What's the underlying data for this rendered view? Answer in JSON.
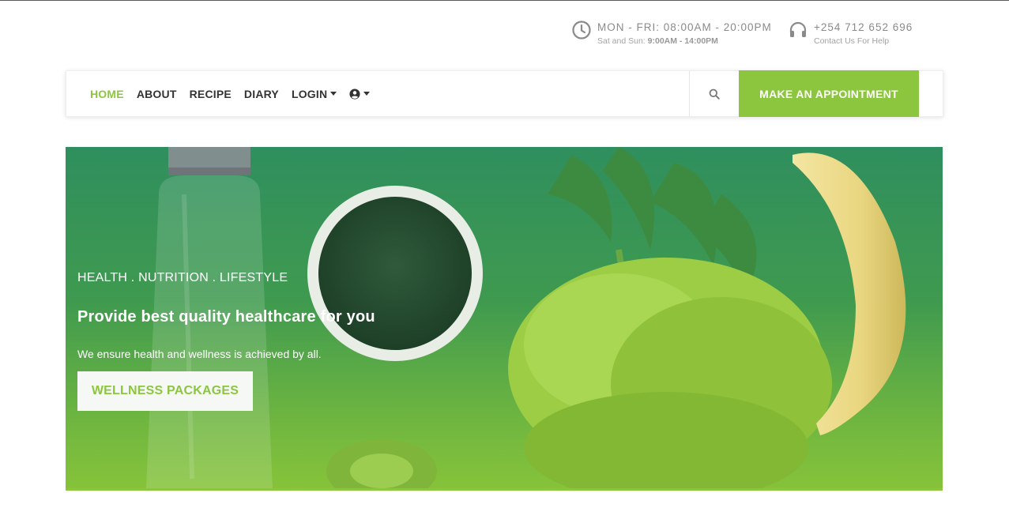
{
  "topbar": {
    "hours": {
      "icon": "clock-icon",
      "line1": "MON - FRI: 08:00AM - 20:00PM",
      "line2_label": "Sat and Sun: ",
      "line2_value": "9:00AM - 14:00PM"
    },
    "phone": {
      "icon": "headset-icon",
      "line1": "+254 712 652 696",
      "line2": "Contact Us For Help"
    }
  },
  "nav": {
    "links": [
      {
        "label": "HOME",
        "active": true
      },
      {
        "label": "ABOUT"
      },
      {
        "label": "RECIPE"
      },
      {
        "label": "DIARY"
      },
      {
        "label": "LOGIN",
        "dropdown": true
      }
    ],
    "user_menu_icon": "user-circle-icon",
    "search_icon": "search-icon",
    "cta_label": "MAKE AN APPOINTMENT"
  },
  "hero": {
    "tagline": "HEALTH . NUTRITION . LIFESTYLE",
    "title": "Provide best quality healthcare for you",
    "subtitle": "We ensure health and wellness is achieved by all.",
    "button_label": "WELLNESS PACKAGES"
  },
  "colors": {
    "accent": "#8cc63f",
    "text_dark": "#333333",
    "muted": "#8a8a8a"
  }
}
